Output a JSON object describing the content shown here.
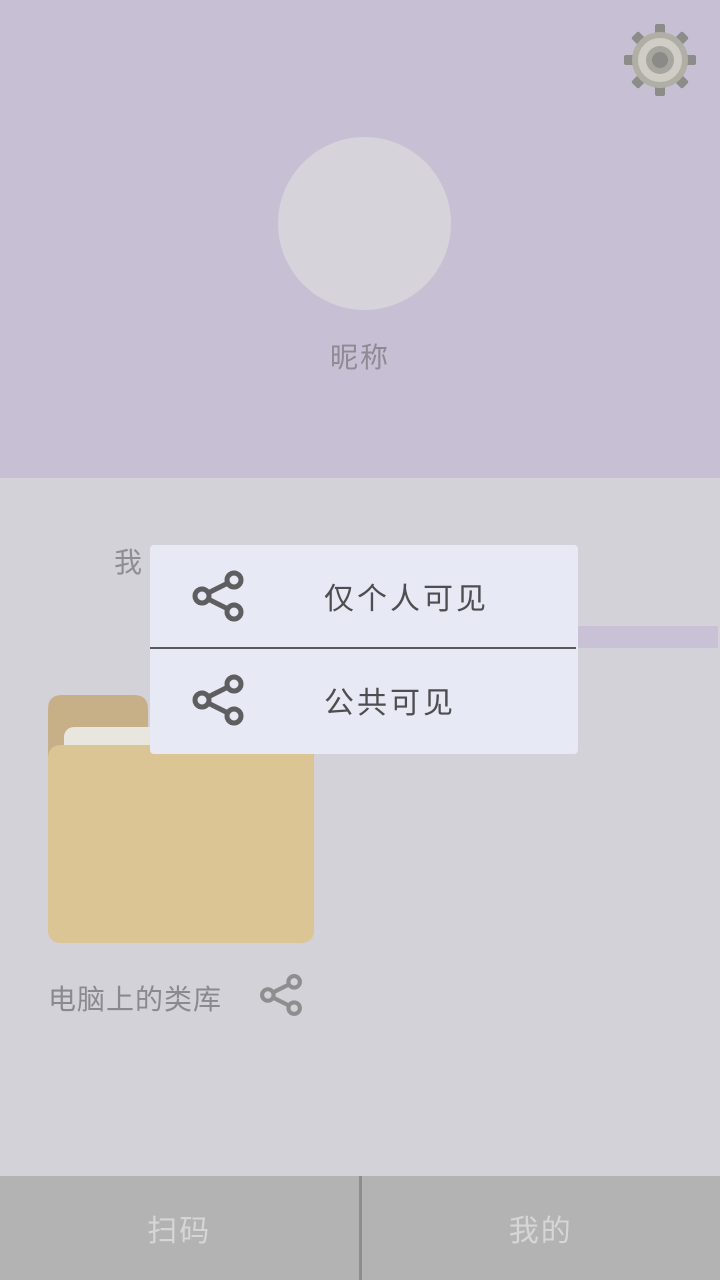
{
  "profile": {
    "nickname": "昵称"
  },
  "content": {
    "section_title_visible": "我",
    "folder_label": "电脑上的类库"
  },
  "popup": {
    "items": [
      {
        "label": "仅个人可见",
        "icon": "share-icon"
      },
      {
        "label": "公共可见",
        "icon": "share-icon"
      }
    ]
  },
  "bottom_nav": {
    "items": [
      {
        "label": "扫码"
      },
      {
        "label": "我的"
      }
    ]
  },
  "colors": {
    "header_bg": "#c7c0d4",
    "body_bg": "#d3d2d9",
    "popup_bg": "#e7e9f5",
    "folder_back": "#c7b088",
    "folder_front": "#dcc594",
    "nav_bg": "#b3b3b3"
  }
}
